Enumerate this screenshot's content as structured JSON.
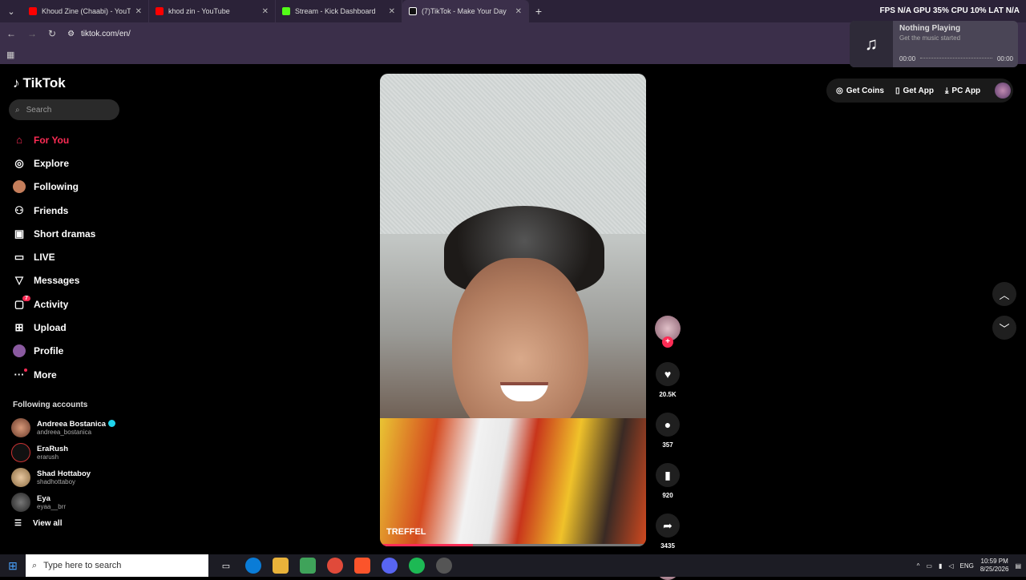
{
  "browser": {
    "tabs": [
      {
        "title": "Khoud Zine (Chaabi) - YouTube",
        "color": "#ff0000"
      },
      {
        "title": "khod zin - YouTube",
        "color": "#ff0000"
      },
      {
        "title": "Stream - Kick Dashboard",
        "color": "#53fc18"
      },
      {
        "title": "(7)TikTok - Make Your Day",
        "color": "#111111"
      }
    ],
    "url": "tiktok.com/en/"
  },
  "overlay": {
    "stats": "FPS N/A   GPU 35%   CPU 10%   LAT N/A",
    "music_title": "Nothing Playing",
    "music_sub": "Get the music started",
    "time_start": "00:00",
    "time_end": "00:00"
  },
  "tiktok": {
    "logo": "TikTok",
    "search_placeholder": "Search",
    "nav": [
      {
        "label": "For You",
        "icon": "home-icon"
      },
      {
        "label": "Explore",
        "icon": "compass-icon"
      },
      {
        "label": "Following",
        "icon": "avatar-icon"
      },
      {
        "label": "Friends",
        "icon": "friends-icon"
      },
      {
        "label": "Short dramas",
        "icon": "film-icon"
      },
      {
        "label": "LIVE",
        "icon": "live-icon"
      },
      {
        "label": "Messages",
        "icon": "send-icon"
      },
      {
        "label": "Activity",
        "icon": "inbox-icon",
        "badge": "7"
      },
      {
        "label": "Upload",
        "icon": "plus-square-icon"
      },
      {
        "label": "Profile",
        "icon": "profile-avatar-icon"
      },
      {
        "label": "More",
        "icon": "more-icon"
      }
    ],
    "following_title": "Following accounts",
    "accounts": [
      {
        "name": "Andreea Bostanica",
        "handle": "andreea_bostanica",
        "verified": true
      },
      {
        "name": "EraRush",
        "handle": "erarush",
        "verified": false
      },
      {
        "name": "Shad Hottaboy",
        "handle": "shadhottaboy",
        "verified": false
      },
      {
        "name": "Eya",
        "handle": "eyaa__brr",
        "verified": false
      }
    ],
    "view_all": "View all",
    "video_label": "TREFFEL",
    "video_progress": 0.35,
    "actions": {
      "likes": "20.5K",
      "comments": "357",
      "saves": "920",
      "shares": "3435"
    },
    "top_buttons": {
      "coins": "Get Coins",
      "app": "Get App",
      "pc": "PC App"
    }
  },
  "taskbar": {
    "search_placeholder": "Type here to search",
    "lang": "ENG",
    "time": "10:59 PM",
    "date": "8/25/2026"
  }
}
